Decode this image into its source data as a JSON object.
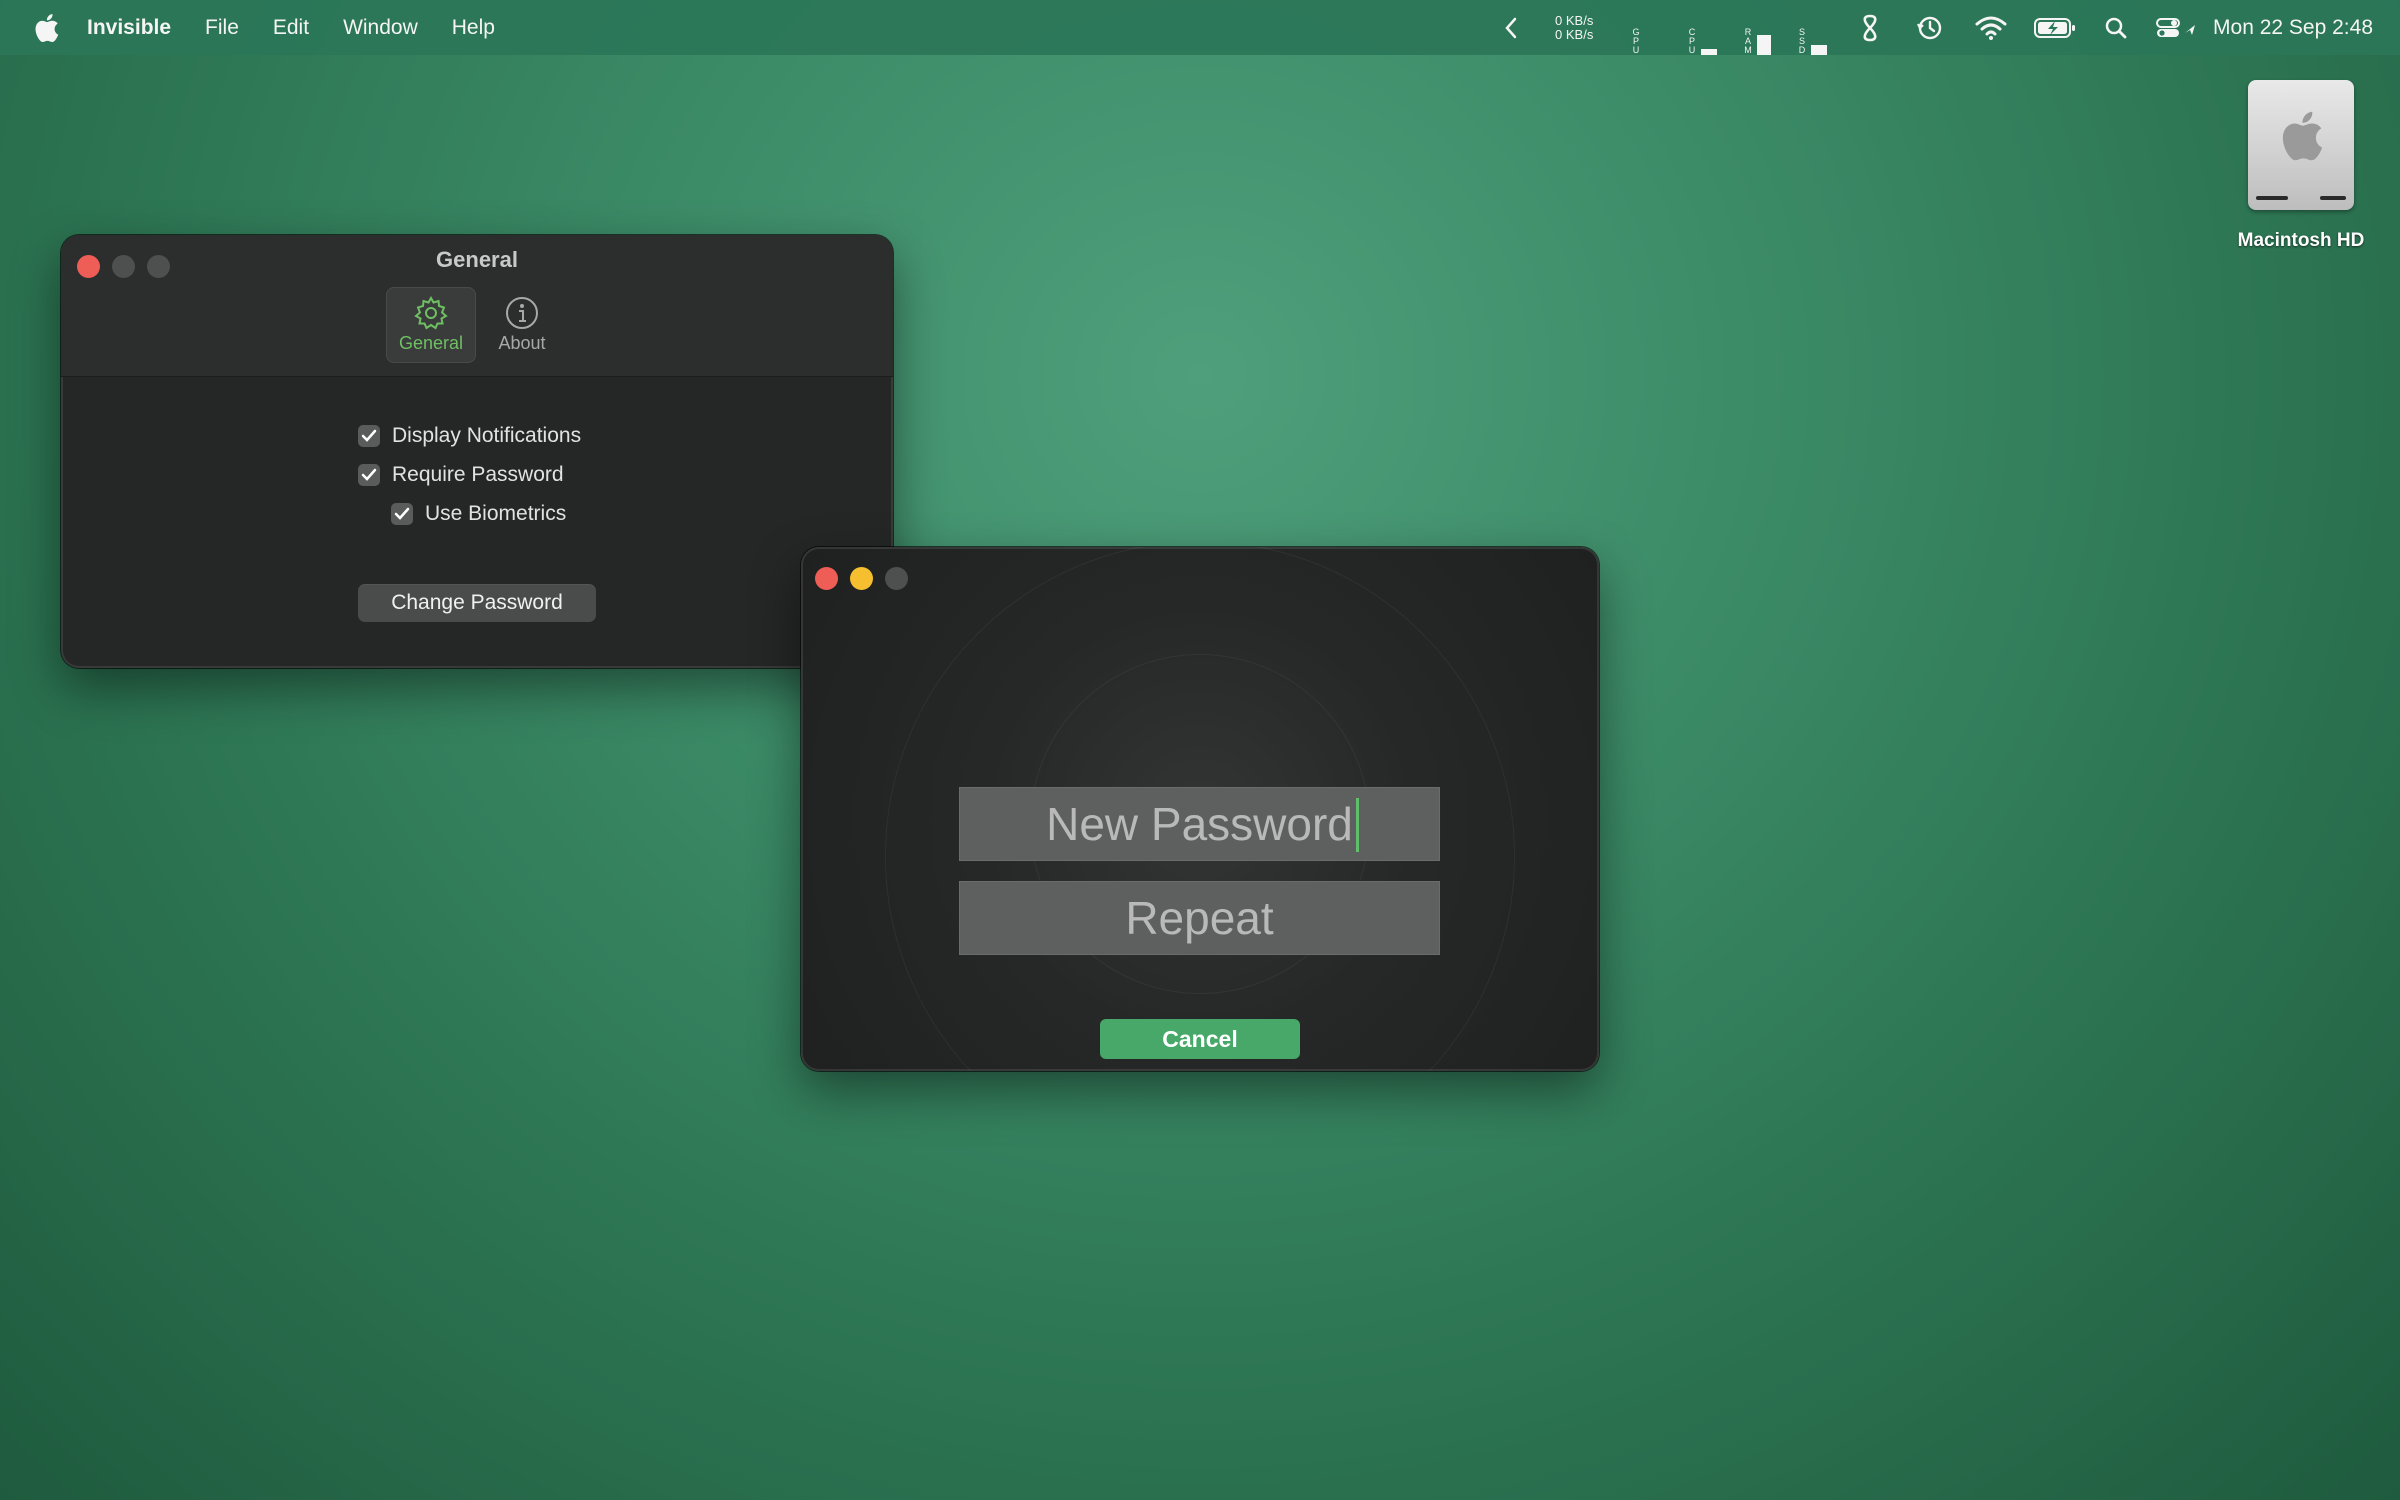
{
  "menubar": {
    "app_name": "Invisible",
    "items": [
      "File",
      "Edit",
      "Window",
      "Help"
    ],
    "net_up": "0 KB/s",
    "net_down": "0 KB/s",
    "gpu_label": "GPU",
    "cpu_label": "CPU",
    "ram_label": "RAM",
    "ssd_label": "SSD",
    "gpu_usage": 0,
    "cpu_usage": 0.2,
    "ram_usage": 0.8,
    "ssd_usage": 0.45,
    "clock": "Mon 22 Sep  2:48",
    "icons": [
      "apple-icon",
      "chevron-left-icon",
      "network-speed",
      "gpu-meter",
      "cpu-meter",
      "ram-meter",
      "ssd-meter",
      "infinity-icon",
      "time-machine-icon",
      "wifi-icon",
      "battery-icon",
      "search-icon",
      "control-center-icon"
    ]
  },
  "desktop": {
    "disk_label": "Macintosh HD"
  },
  "general_window": {
    "title": "General",
    "tabs": [
      {
        "label": "General",
        "icon": "gear-icon",
        "active": true
      },
      {
        "label": "About",
        "icon": "info-icon",
        "active": false
      }
    ],
    "options": [
      {
        "label": "Display Notifications",
        "checked": true
      },
      {
        "label": "Require Password",
        "checked": true
      },
      {
        "label": "Use Biometrics",
        "checked": true
      }
    ],
    "change_password_label": "Change Password"
  },
  "password_window": {
    "new_password_placeholder": "New Password",
    "repeat_placeholder": "Repeat",
    "cancel_label": "Cancel"
  },
  "colors": {
    "accent_green": "#6fbf63",
    "cancel_button": "#47a86a",
    "close_red": "#ee5e57",
    "minimize_yellow": "#f5bf2f"
  }
}
